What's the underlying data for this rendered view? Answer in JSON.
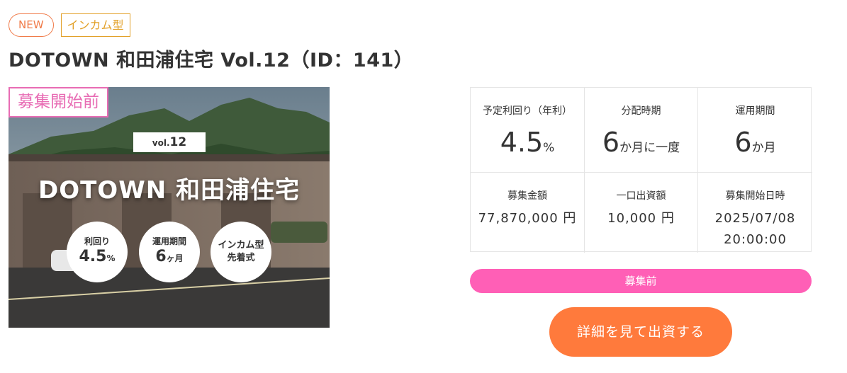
{
  "tags": {
    "new": "NEW",
    "type": "インカム型"
  },
  "title": "DOTOWN 和田浦住宅 Vol.12（ID：141）",
  "hero": {
    "ribbon": "募集開始前",
    "vol_prefix": "vol.",
    "vol_number": "12",
    "name": "DOTOWN 和田浦住宅",
    "badges": [
      {
        "label": "利回り",
        "value": "4.5",
        "unit": "%"
      },
      {
        "label": "運用期間",
        "value": "6",
        "unit": "ヶ月"
      },
      {
        "label": "インカム型",
        "value2": "先着式"
      }
    ]
  },
  "stats": {
    "yield": {
      "label": "予定利回り（年利）",
      "value": "4.5",
      "unit": "%"
    },
    "dist": {
      "label": "分配時期",
      "value": "6",
      "unit": "か月に一度"
    },
    "period": {
      "label": "運用期間",
      "value": "6",
      "unit": "か月"
    },
    "amount": {
      "label": "募集金額",
      "value": "77,870,000 円"
    },
    "unit_price": {
      "label": "一口出資額",
      "value": "10,000 円"
    },
    "start": {
      "label": "募集開始日時",
      "date": "2025/07/08",
      "time": "20:00:00"
    }
  },
  "status": "募集前",
  "cta": "詳細を見て出資する",
  "colors": {
    "accent_orange": "#ff7a3c",
    "status_pink": "#ff5fb6",
    "tag_orange": "#f07a48",
    "tag_gold": "#e2a027"
  }
}
